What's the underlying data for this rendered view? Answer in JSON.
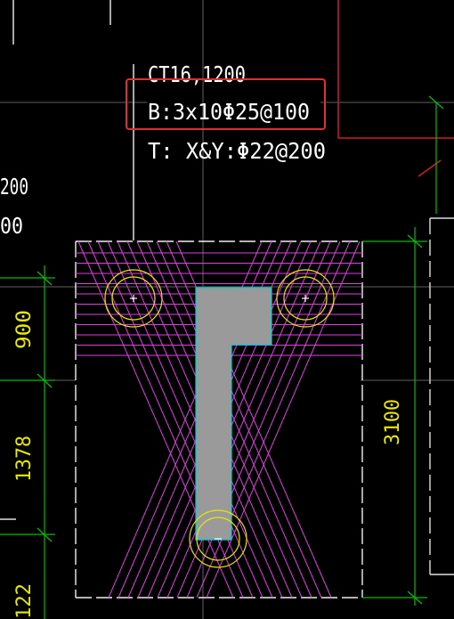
{
  "annotation": {
    "line1": "CT16,1200",
    "line2": "B:3x10Φ25@100",
    "line3": "T: X&Y:Φ22@200"
  },
  "left_fragments": {
    "a": "200",
    "b": "00"
  },
  "dimensions": {
    "left_top": "900",
    "left_mid": "1378",
    "left_bottom": "122",
    "right_total": "3100"
  },
  "colors": {
    "background": "#000000",
    "rebar": "#e040e0",
    "dimension": "#00c000",
    "dim_text": "#e8e800",
    "annotation": "#ffffff",
    "highlight_box": "#e03030",
    "column": "#9a9a9a",
    "column_outline": "#00d0d0",
    "pile": "#e8e800",
    "red_line": "#d02020",
    "outline": "#ffffff"
  }
}
